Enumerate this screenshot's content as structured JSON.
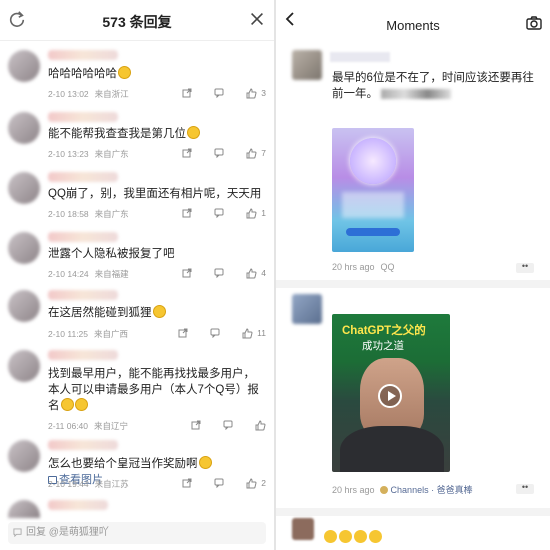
{
  "left_panel": {
    "header": {
      "title": "573 条回复"
    },
    "comments": [
      {
        "text": "哈哈哈哈哈哈",
        "emoji": true,
        "date": "2-10 13:02",
        "location": "来自浙江",
        "likes": "3"
      },
      {
        "text": "能不能帮我查查我是第几位",
        "emoji": true,
        "date": "2-10 13:23",
        "location": "来自广东",
        "likes": "7"
      },
      {
        "text": "QQ崩了，别，我里面还有相片呢，天天用",
        "emoji": false,
        "date": "2-10 18:58",
        "location": "来自广东",
        "likes": "1"
      },
      {
        "text": "泄露个人隐私被报复了吧",
        "emoji": false,
        "date": "2-10 14:24",
        "location": "来自福建",
        "likes": "4"
      },
      {
        "text": "在这居然能碰到狐狸",
        "emoji": true,
        "date": "2-10 11:25",
        "location": "来自广西",
        "likes": "11"
      },
      {
        "text": "找到最早用户，能不能再找找最多用户，本人可以申请最多用户（本人7个Q号）报名",
        "emoji": true,
        "date": "2-11 06:40",
        "location": "来自辽宁",
        "likes": ""
      },
      {
        "text": "怎么也要给个皇冠当作奖励啊",
        "emoji": true,
        "view_images": "查看图片",
        "date": "2-10 19:44",
        "location": "来自江苏",
        "likes": "2"
      }
    ],
    "reply_bar": {
      "placeholder": "回复 @是萌狐狸吖"
    }
  },
  "right_panel": {
    "header": {
      "title": "Moments"
    },
    "post1": {
      "text": "最早的6位是不在了，时间应该还要再往前一年。",
      "time": "20 hrs ago",
      "source": "QQ"
    },
    "post2": {
      "video_title": "ChatGPT之父的",
      "video_subtitle": "成功之道",
      "time": "20 hrs ago",
      "channel": "Channels · 爸爸真棒"
    }
  },
  "colors": {
    "accent_link": "#576b95",
    "meta_gray": "#999999",
    "emoji_yellow": "#f6c631",
    "video_title_yellow": "#ffe64d"
  },
  "icons": [
    "refresh-icon",
    "close-icon",
    "share-icon",
    "comment-icon",
    "like-icon",
    "image-icon",
    "reply-icon",
    "back-icon",
    "camera-icon",
    "play-icon",
    "more-icon"
  ]
}
